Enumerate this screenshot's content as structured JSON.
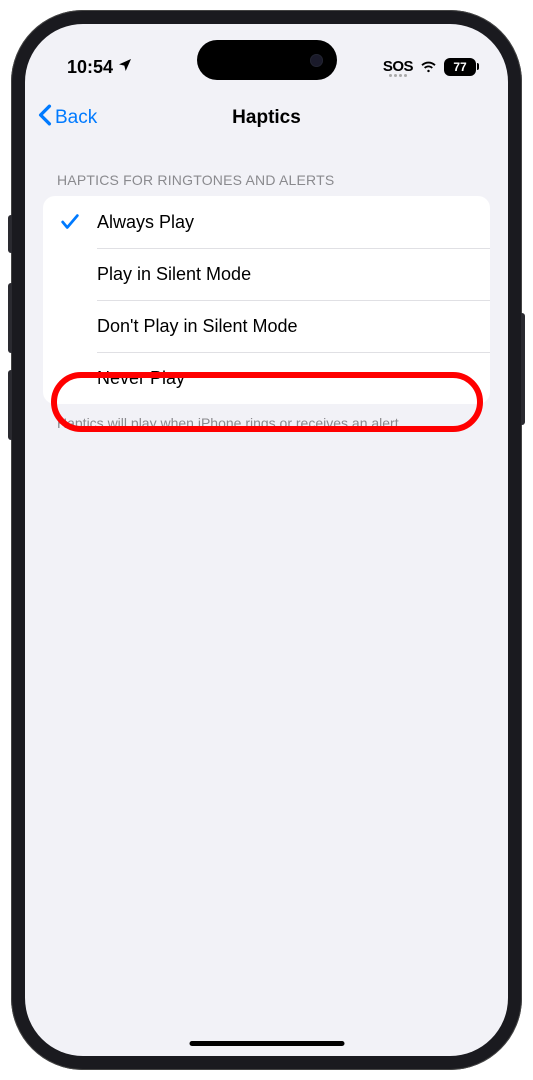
{
  "status": {
    "time": "10:54",
    "sos": "SOS",
    "battery": "77"
  },
  "nav": {
    "back": "Back",
    "title": "Haptics"
  },
  "section": {
    "header": "HAPTICS FOR RINGTONES AND ALERTS",
    "footer": "Haptics will play when iPhone rings or receives an alert."
  },
  "options": [
    {
      "label": "Always Play",
      "selected": true
    },
    {
      "label": "Play in Silent Mode",
      "selected": false
    },
    {
      "label": "Don't Play in Silent Mode",
      "selected": false
    },
    {
      "label": "Never Play",
      "selected": false
    }
  ]
}
